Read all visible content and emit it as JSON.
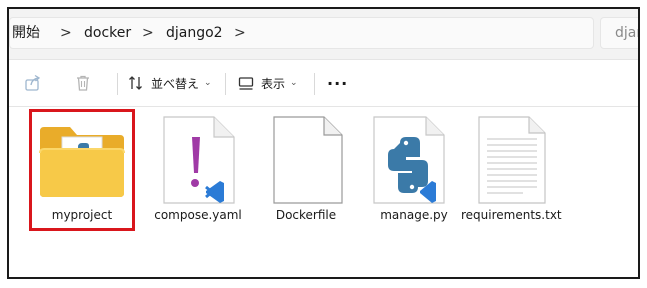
{
  "breadcrumb": {
    "items": [
      "開始",
      "docker",
      "django2"
    ],
    "separator": ">",
    "search_partial": "djan"
  },
  "toolbar": {
    "share_icon": "share-icon",
    "delete_icon": "trash-icon",
    "sort_label": "並べ替え",
    "view_label": "表示",
    "more_label": "···"
  },
  "files": [
    {
      "name": "myproject",
      "icon": "folder-icon",
      "selected": true
    },
    {
      "name": "compose.yaml",
      "icon": "yaml-vscode-icon",
      "selected": false
    },
    {
      "name": "Dockerfile",
      "icon": "blank-file-icon",
      "selected": false
    },
    {
      "name": "manage.py",
      "icon": "python-vscode-icon",
      "selected": false
    },
    {
      "name": "requirements.txt",
      "icon": "text-file-icon",
      "selected": false
    }
  ],
  "colors": {
    "selection_outline": "#d9161c",
    "folder_yellow": "#f7c948",
    "python_blue": "#3b7aa8",
    "vscode_blue": "#2b7bd6",
    "yaml_purple": "#a03aa6"
  }
}
